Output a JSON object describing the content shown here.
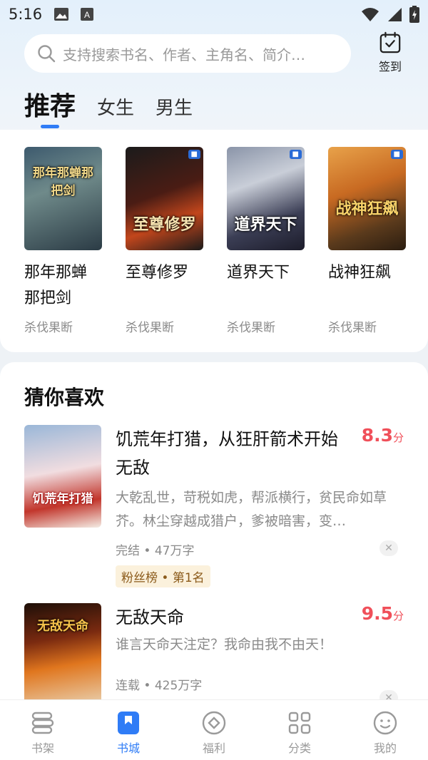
{
  "status": {
    "time": "5:16"
  },
  "search": {
    "placeholder": "支持搜索书名、作者、主角名、简介…"
  },
  "checkin": {
    "label": "签到"
  },
  "tabs": [
    {
      "label": "推荐",
      "active": true
    },
    {
      "label": "女生",
      "active": false
    },
    {
      "label": "男生",
      "active": false
    }
  ],
  "recommend": {
    "books": [
      {
        "title_line1": "那年那蝉",
        "title_line2": "那把剑",
        "author": "杀伐果断",
        "cover_text": "那年那蝉那把剑"
      },
      {
        "title_line1": "至尊修罗",
        "title_line2": "",
        "author": "杀伐果断",
        "cover_text": "至尊修罗"
      },
      {
        "title_line1": "道界天下",
        "title_line2": "",
        "author": "杀伐果断",
        "cover_text": "道界天下"
      },
      {
        "title_line1": "战神狂飙",
        "title_line2": "",
        "author": "杀伐果断",
        "cover_text": "战神狂飙"
      }
    ]
  },
  "guess": {
    "title": "猜你喜欢",
    "items": [
      {
        "title": "饥荒年打猎，从狂肝箭术开始无敌",
        "score": "8.3",
        "score_unit": "分",
        "desc": "大乾乱世，苛税如虎，帮派横行，贫民命如草芥。林尘穿越成猎户，爹被暗害，变…",
        "meta": "完结 • 47万字",
        "tag": "粉丝榜 • 第1名",
        "cover_text": "饥荒年打猎"
      },
      {
        "title": "无敌天命",
        "score": "9.5",
        "score_unit": "分",
        "desc": "谁言天命天注定？我命由我不由天！",
        "meta": "连载 • 425万字",
        "cover_text": "无敌天命"
      }
    ]
  },
  "nav": [
    {
      "label": "书架",
      "icon": "bookshelf-icon",
      "active": false
    },
    {
      "label": "书城",
      "icon": "bookstore-icon",
      "active": true
    },
    {
      "label": "福利",
      "icon": "welfare-icon",
      "active": false
    },
    {
      "label": "分类",
      "icon": "category-icon",
      "active": false
    },
    {
      "label": "我的",
      "icon": "profile-icon",
      "active": false
    }
  ],
  "colors": {
    "accent": "#2f7cf6",
    "score": "#f0505a",
    "tag_bg": "#fbf1dc"
  }
}
